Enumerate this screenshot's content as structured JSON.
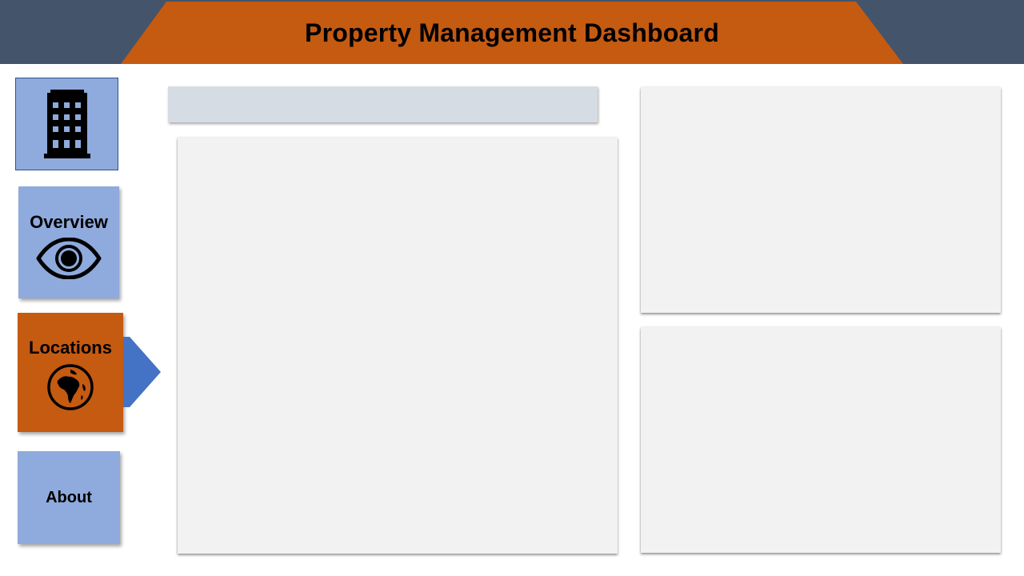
{
  "header": {
    "title": "Property Management Dashboard",
    "band_color": "#c55a11",
    "background_color": "#44546a"
  },
  "sidebar": {
    "logo": {
      "icon": "office-building-icon"
    },
    "items": [
      {
        "id": "overview",
        "label": "Overview",
        "icon": "eye-icon",
        "active": false,
        "color": "#8faadc"
      },
      {
        "id": "locations",
        "label": "Locations",
        "icon": "globe-africa-icon",
        "active": true,
        "color": "#c55a11"
      },
      {
        "id": "about",
        "label": "About",
        "icon": "",
        "active": false,
        "color": "#8faadc"
      }
    ],
    "active_indicator_color": "#4472c4"
  },
  "main": {
    "filter_bar_color": "#d6dce4",
    "panel_color": "#f2f2f2"
  }
}
